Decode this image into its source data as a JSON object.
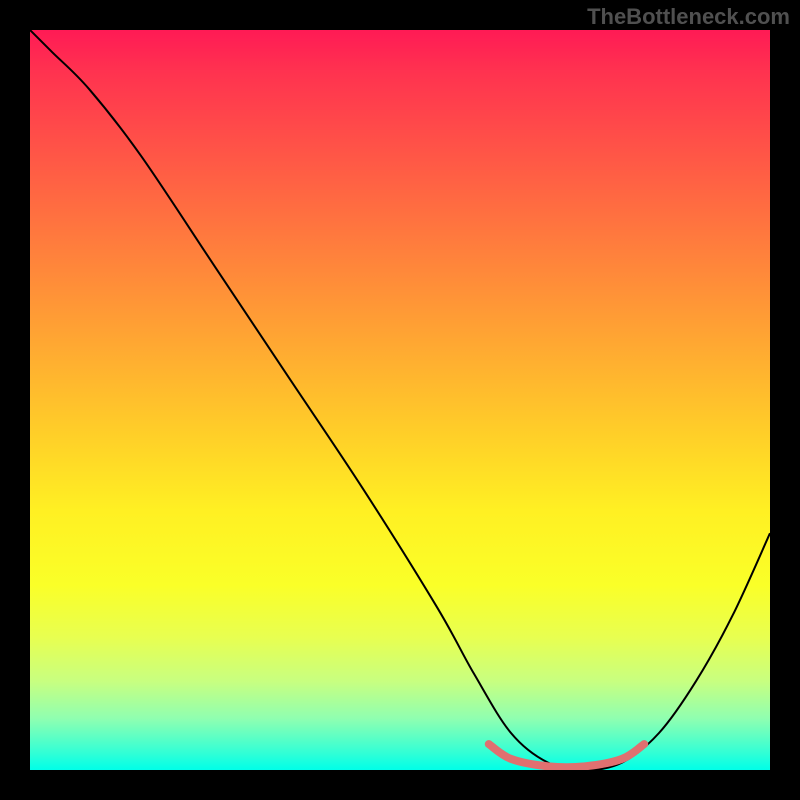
{
  "watermark_text": "TheBottleneck.com",
  "chart_data": {
    "type": "line",
    "title": "",
    "xlabel": "",
    "ylabel": "",
    "xlim": [
      0,
      100
    ],
    "ylim": [
      0,
      100
    ],
    "background_gradient": {
      "top_color": "#ff1a55",
      "middle_color": "#fff020",
      "bottom_color": "#00ffe8",
      "orientation": "vertical"
    },
    "series": [
      {
        "name": "bottleneck-curve",
        "color": "#000000",
        "stroke_width": 2,
        "x": [
          0,
          3,
          8,
          15,
          25,
          35,
          45,
          55,
          60,
          65,
          70,
          75,
          80,
          85,
          90,
          95,
          100
        ],
        "y": [
          100,
          97,
          92,
          83,
          68,
          53,
          38,
          22,
          13,
          5,
          1,
          0,
          1,
          5,
          12,
          21,
          32
        ]
      },
      {
        "name": "highlight-segment",
        "color": "#e07070",
        "stroke_width": 8,
        "x": [
          62,
          65,
          70,
          75,
          80,
          83
        ],
        "y": [
          3.5,
          1.5,
          0.5,
          0.5,
          1.5,
          3.5
        ]
      }
    ]
  }
}
